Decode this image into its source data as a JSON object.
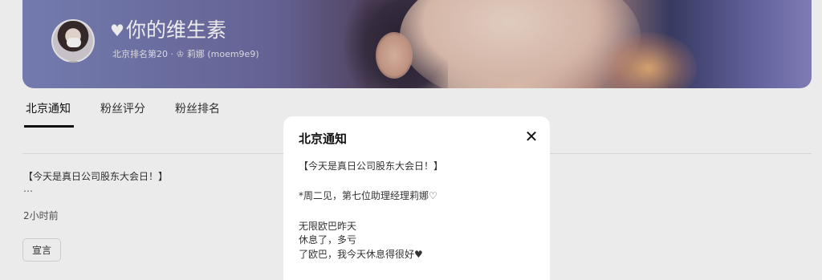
{
  "header": {
    "title": "你的维生素",
    "subtitle": "北京排名第20 · ♔ 莉娜 (moem9e9)",
    "heart_icon": "heart-icon",
    "avatar_icon": "avatar"
  },
  "tabs": [
    {
      "label": "北京通知",
      "active": true
    },
    {
      "label": "粉丝评分",
      "active": false
    },
    {
      "label": "粉丝排名",
      "active": false
    }
  ],
  "post": {
    "text": "【今天是真日公司股东大会日！】",
    "ellipsis": "…",
    "time": "2小时前",
    "tag_label": "宣言"
  },
  "modal": {
    "title": "北京通知",
    "close_icon": "close-icon",
    "lines": [
      "【今天是真日公司股东大会日！】",
      "*周二见，第七位助理经理莉娜♡",
      "无限欧巴昨天",
      "休息了，多亏",
      "了欧巴，我今天休息得很好♥"
    ]
  },
  "colors": {
    "banner_left": "#7d86bd",
    "banner_right": "#8a86c4",
    "active_tab_underline": "#111111",
    "overlay": "rgba(0,0,0,0.08)"
  }
}
